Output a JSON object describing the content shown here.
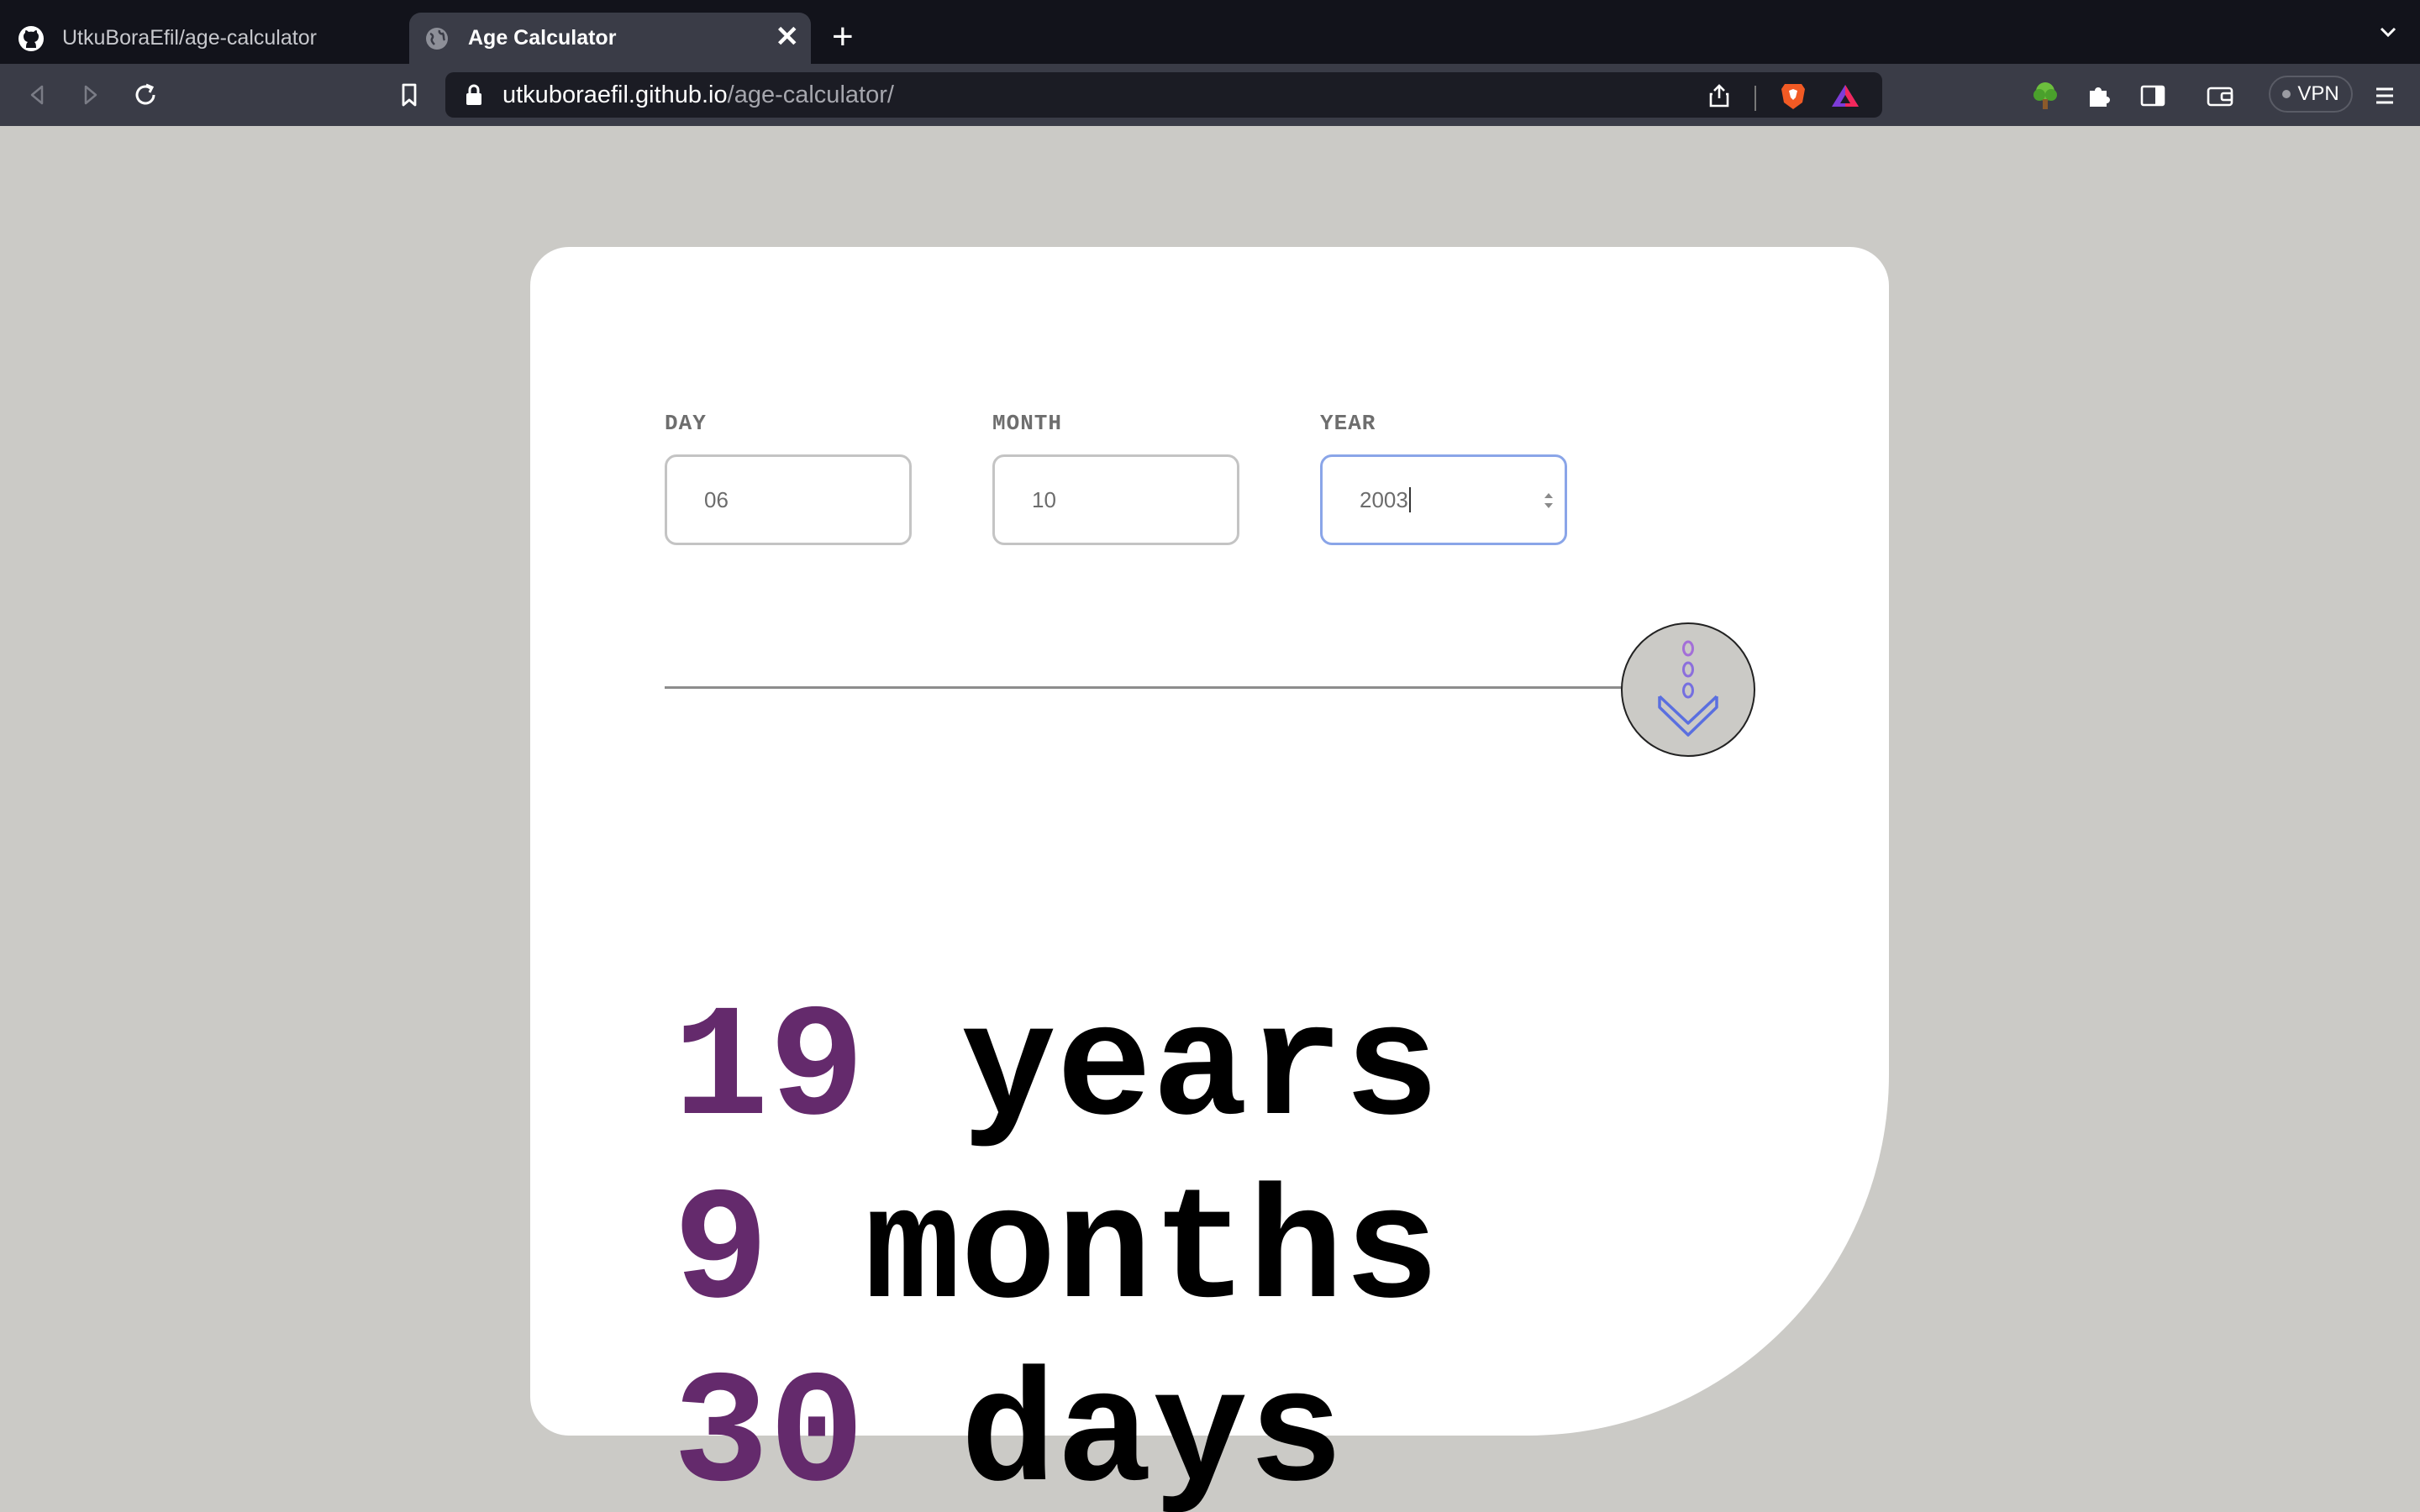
{
  "browser": {
    "tabs": [
      {
        "title": "UtkuBoraEfil/age-calculator",
        "icon": "github-icon",
        "active": false
      },
      {
        "title": "Age Calculator",
        "icon": "globe-icon",
        "active": true
      }
    ],
    "url": {
      "host": "utkuboraefil.github.io",
      "path": "/age-calculator/"
    },
    "vpn_label": "VPN"
  },
  "form": {
    "day": {
      "label": "DAY",
      "value": "06"
    },
    "month": {
      "label": "MONTH",
      "value": "10"
    },
    "year": {
      "label": "YEAR",
      "value": "2003"
    },
    "submit_icon": "arrow-down-icon"
  },
  "result": {
    "years": {
      "value": "19",
      "unit": "years"
    },
    "months": {
      "value": "9",
      "unit": "months"
    },
    "days": {
      "value": "30",
      "unit": "days"
    }
  },
  "colors": {
    "background": "#cbcac6",
    "card": "#ffffff",
    "accent": "#642a6c",
    "focus": "#8aa5e8",
    "icon_purple": "#a36fd8",
    "icon_blue": "#5a6fe0"
  }
}
